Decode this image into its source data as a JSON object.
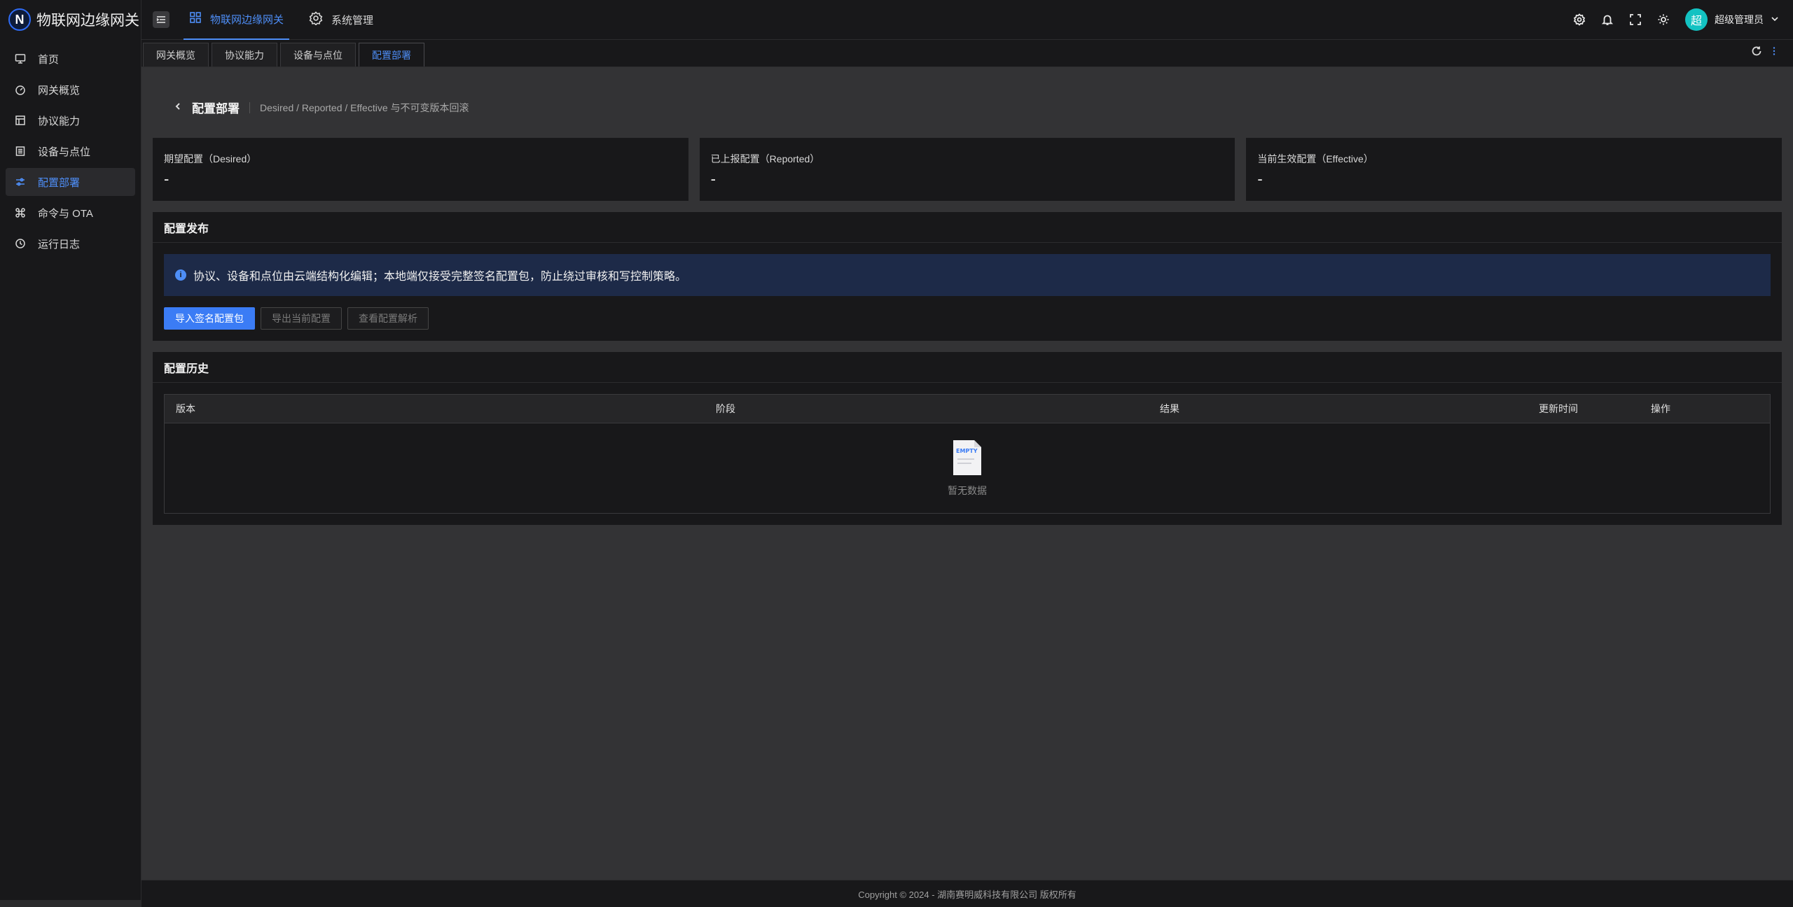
{
  "brand": {
    "title": "物联网边缘网关",
    "logo_letter": "N"
  },
  "sidebar": {
    "items": [
      {
        "label": "首页",
        "icon": "monitor-icon",
        "active": false
      },
      {
        "label": "网关概览",
        "icon": "dashboard-icon",
        "active": false
      },
      {
        "label": "协议能力",
        "icon": "layout-icon",
        "active": false
      },
      {
        "label": "设备与点位",
        "icon": "list-icon",
        "active": false
      },
      {
        "label": "配置部署",
        "icon": "sliders-icon",
        "active": true
      },
      {
        "label": "命令与 OTA",
        "icon": "command-icon",
        "active": false
      },
      {
        "label": "运行日志",
        "icon": "clock-icon",
        "active": false
      }
    ]
  },
  "header": {
    "menus": [
      {
        "label": "物联网边缘网关",
        "icon": "grid-icon",
        "active": true
      },
      {
        "label": "系统管理",
        "icon": "gear-icon",
        "active": false
      }
    ],
    "user": {
      "avatar_char": "超",
      "name": "超级管理员"
    }
  },
  "tabs": [
    {
      "label": "网关概览",
      "active": false
    },
    {
      "label": "协议能力",
      "active": false
    },
    {
      "label": "设备与点位",
      "active": false
    },
    {
      "label": "配置部署",
      "active": true
    }
  ],
  "page": {
    "title": "配置部署",
    "subtitle": "Desired / Reported / Effective 与不可变版本回滚"
  },
  "cards": [
    {
      "label": "期望配置（Desired）",
      "value": "-"
    },
    {
      "label": "已上报配置（Reported）",
      "value": "-"
    },
    {
      "label": "当前生效配置（Effective）",
      "value": "-"
    }
  ],
  "publish": {
    "title": "配置发布",
    "alert": "协议、设备和点位由云端结构化编辑；本地端仅接受完整签名配置包，防止绕过审核和写控制策略。",
    "buttons": {
      "import": "导入签名配置包",
      "export": "导出当前配置",
      "view": "查看配置解析"
    }
  },
  "history": {
    "title": "配置历史",
    "columns": [
      "版本",
      "阶段",
      "结果",
      "更新时间",
      "操作"
    ],
    "empty_text": "暂无数据",
    "empty_badge": "EMPTY"
  },
  "footer": {
    "text": "Copyright © 2024 - 湖南赛明威科技有限公司 版权所有"
  },
  "colors": {
    "accent": "#4e8ef7",
    "primary_button": "#3b7cf5",
    "avatar": "#13c2c2",
    "alert_bg": "#1d2a48"
  }
}
